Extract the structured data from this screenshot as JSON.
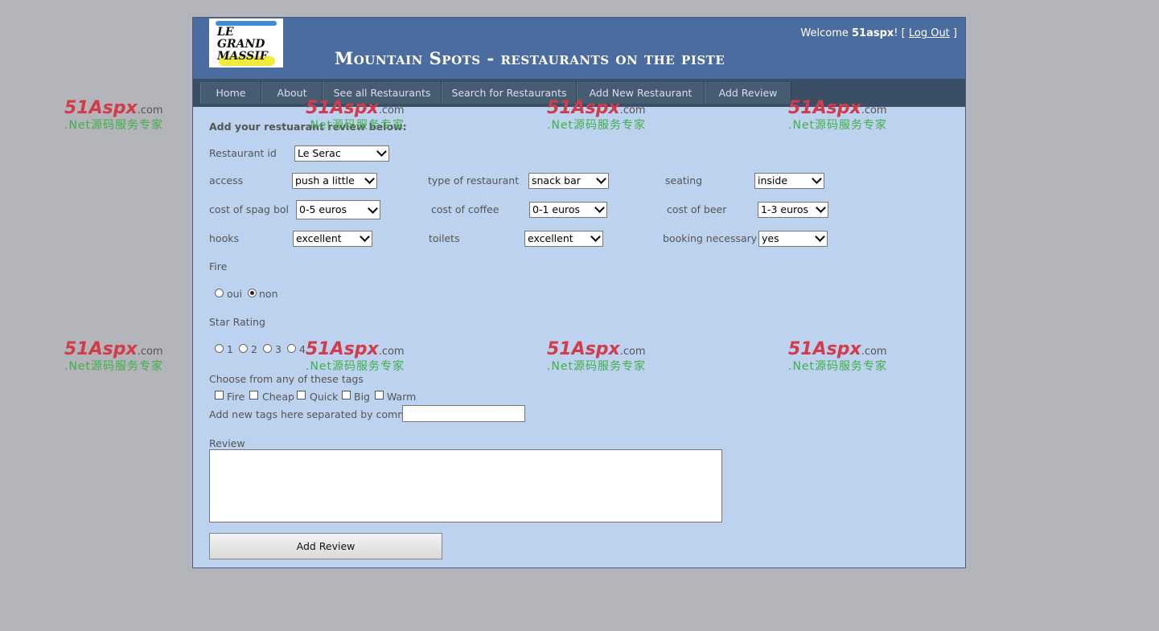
{
  "header": {
    "logo_text": "LE GRAND MASSIF",
    "title": "Mountain Spots  - restaurants on the piste",
    "welcome": "Welcome ",
    "username": "51aspx",
    "after_user": "! [ ",
    "logout": "Log Out",
    "close_bracket": " ]"
  },
  "nav": [
    "Home",
    "About",
    "See all Restaurants",
    "Search for Restaurants",
    "Add New Restaurant",
    "Add Review"
  ],
  "form": {
    "heading": "Add your restuarant review below:",
    "restaurant_id": {
      "label": "Restaurant id",
      "value": "Le Serac"
    },
    "access": {
      "label": "access",
      "value": "push a little"
    },
    "type": {
      "label": "type of restaurant",
      "value": "snack bar"
    },
    "seating": {
      "label": "seating",
      "value": "inside"
    },
    "spag": {
      "label": "cost of spag bol",
      "value": "0-5 euros"
    },
    "coffee": {
      "label": "cost of coffee",
      "value": "0-1 euros"
    },
    "beer": {
      "label": "cost of beer",
      "value": "1-3 euros"
    },
    "hooks": {
      "label": "hooks",
      "value": "excellent"
    },
    "toilets": {
      "label": "toilets",
      "value": "excellent"
    },
    "booking": {
      "label": "booking necessary",
      "value": "yes"
    },
    "fire": {
      "label": "Fire",
      "options": [
        "oui",
        "non"
      ],
      "selected": "non"
    },
    "stars": {
      "label": "Star Rating",
      "options": [
        "1",
        "2",
        "3",
        "4"
      ]
    },
    "tags": {
      "label": "Choose from any of these tags",
      "options": [
        "Fire",
        "Cheap",
        "Quick",
        "Big",
        "Warm"
      ]
    },
    "new_tags": {
      "label": "Add new tags here separated by commas:",
      "value": ""
    },
    "review": {
      "label": "Review",
      "value": ""
    },
    "submit": "Add Review"
  },
  "watermark": {
    "brand": "51Aspx",
    "suffix": ".com",
    "tagline": ".Net源码服务专家"
  }
}
